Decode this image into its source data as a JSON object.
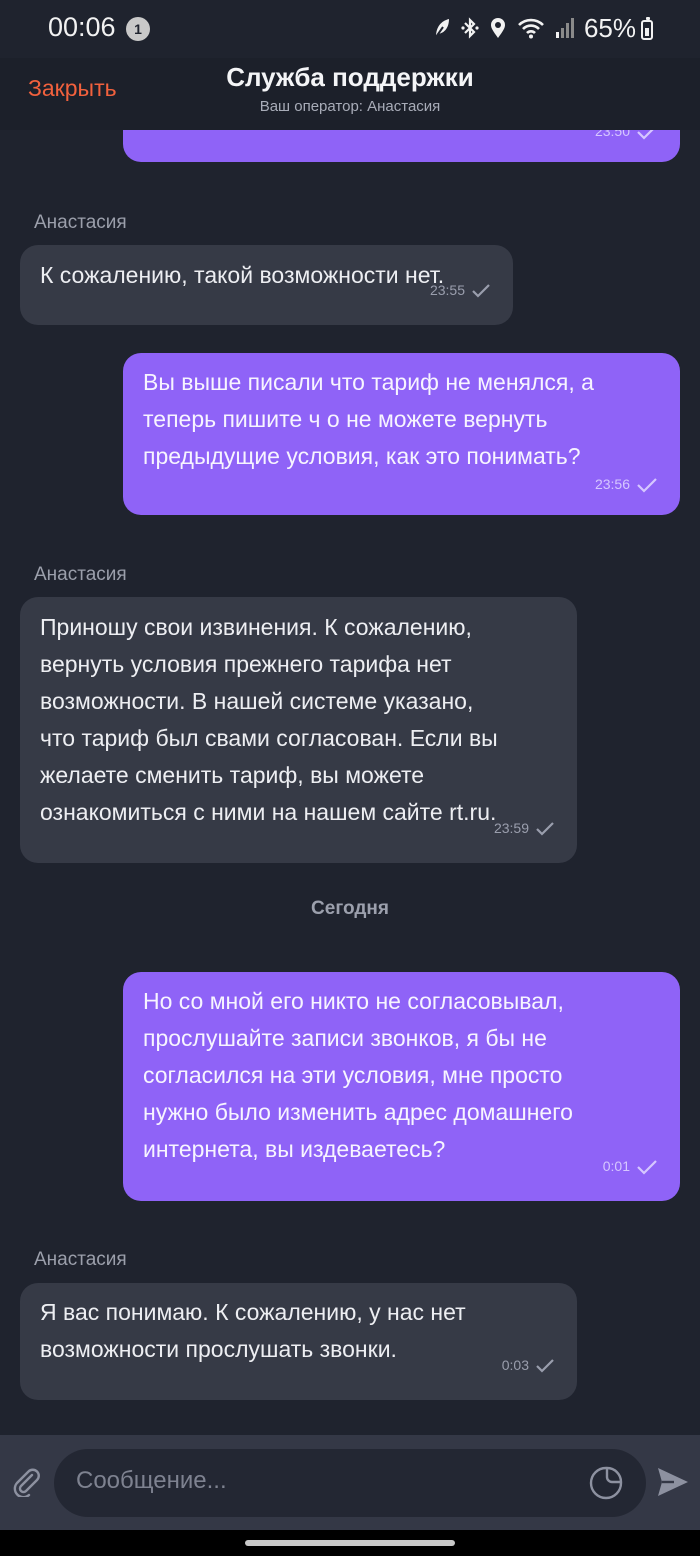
{
  "status_bar": {
    "time": "00:06",
    "notification_count": "1",
    "battery": "65%"
  },
  "header": {
    "close_label": "Закрыть",
    "title": "Служба поддержки",
    "subtitle": "Ваш оператор: Анастасия"
  },
  "messages": [
    {
      "type": "outgoing",
      "text": "",
      "time": "23:50"
    },
    {
      "type": "incoming",
      "sender": "Анастасия",
      "text": "К сожалению, такой возможности нет.",
      "time": "23:55"
    },
    {
      "type": "outgoing",
      "text": "Вы выше писали что тариф не менялся, а\nтеперь пишите ч о не можете вернуть\nпредыдущие условия, как это понимать?",
      "time": "23:56"
    },
    {
      "type": "incoming",
      "sender": "Анастасия",
      "text": "Приношу свои извинения. К сожалению,\nвернуть условия прежнего тарифа нет\nвозможности. В нашей системе указано,\nчто тариф был свами согласован. Если вы\nжелаете сменить тариф, вы можете\nознакомиться с ними на нашем сайте rt.ru.",
      "time": "23:59"
    },
    {
      "type": "outgoing",
      "text": "Но со мной его никто не согласовывал,\nпрослушайте записи звонков, я бы не\nсогласился на эти условия, мне просто\nнужно было изменить адрес домашнего\nинтернета, вы издеваетесь?",
      "time": "0:01"
    },
    {
      "type": "incoming",
      "sender": "Анастасия",
      "text": "Я вас понимаю. К сожалению, у нас нет\nвозможности прослушать звонки.",
      "time": "0:03"
    }
  ],
  "day_separator": "Сегодня",
  "composer": {
    "placeholder": "Сообщение..."
  },
  "colors": {
    "background": "#1f232e",
    "incoming_bubble": "#363a46",
    "outgoing_bubble": "#8f63f7",
    "accent": "#f2613d"
  },
  "icons": [
    "leaf-icon",
    "bluetooth-icon",
    "location-icon",
    "wifi-icon",
    "signal-icon",
    "battery-icon",
    "attach-icon",
    "sticker-icon",
    "send-icon",
    "check-icon"
  ]
}
